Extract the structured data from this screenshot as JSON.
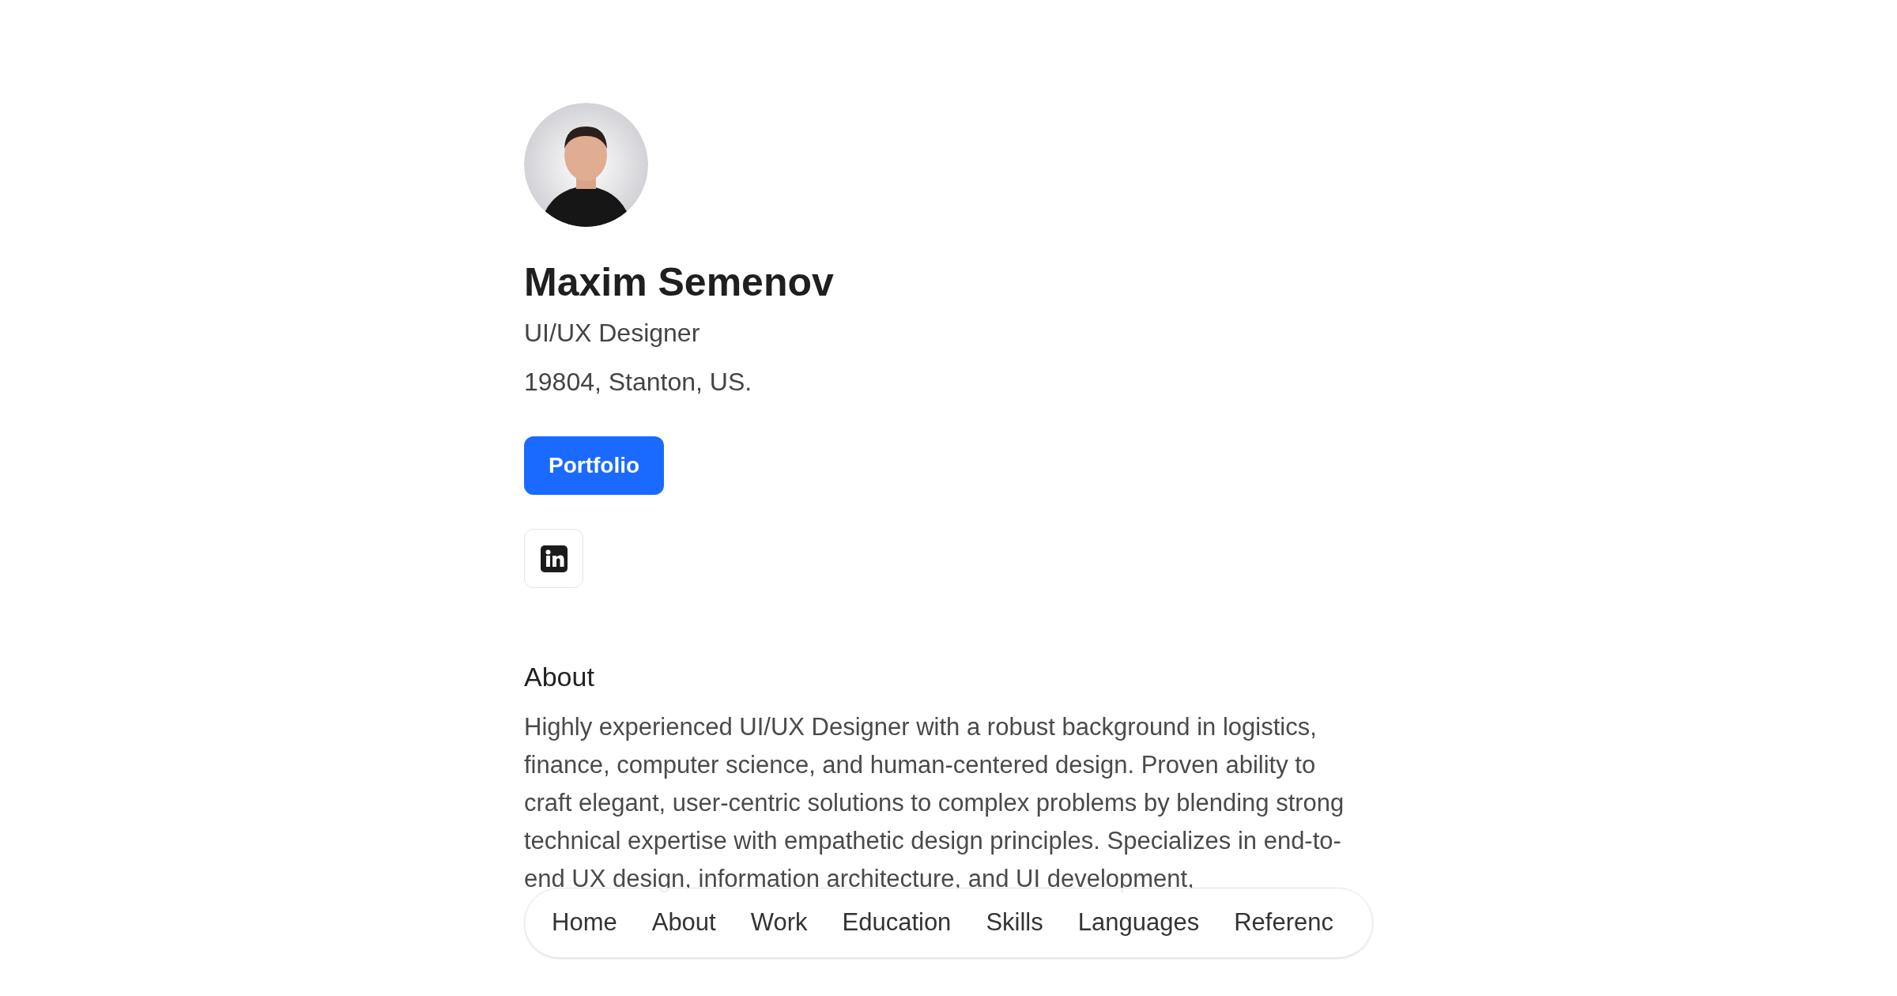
{
  "profile": {
    "name": "Maxim Semenov",
    "title": "UI/UX Designer",
    "location": "19804, Stanton, US.",
    "portfolio_button": "Portfolio",
    "social_links": [
      {
        "kind": "linkedin"
      }
    ]
  },
  "about": {
    "heading": "About",
    "text": "Highly experienced UI/UX Designer with a robust background in logistics, finance, computer science, and human-centered design. Proven ability to craft elegant, user-centric solutions to complex problems by blending strong technical expertise with empathetic design principles. Specializes in end-to-end UX design, information architecture, and UI development,"
  },
  "nav": {
    "items": [
      {
        "label": "Home"
      },
      {
        "label": "About"
      },
      {
        "label": "Work"
      },
      {
        "label": "Education"
      },
      {
        "label": "Skills"
      },
      {
        "label": "Languages"
      },
      {
        "label": "Referenc"
      }
    ]
  }
}
